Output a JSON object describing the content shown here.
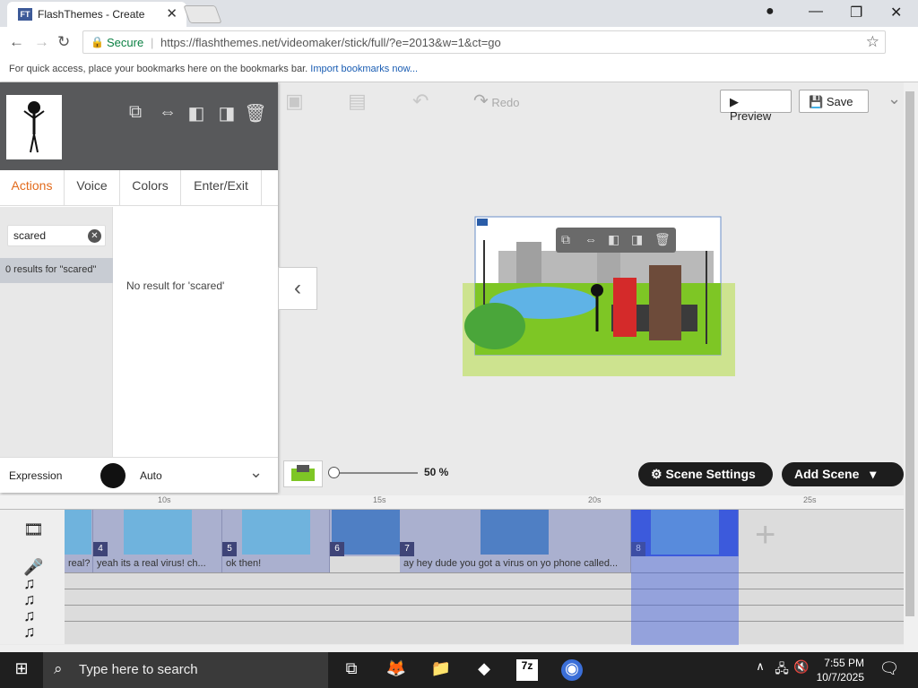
{
  "browser": {
    "tab_title": "FlashThemes - Create",
    "favicon_text": "FT",
    "secure_label": "Secure",
    "url": "https://flashthemes.net/videomaker/stick/full/?e=2013&w=1&ct=go",
    "bookmarks_prompt": "For quick access, place your bookmarks here on the bookmarks bar.",
    "bookmarks_link": "Import bookmarks now..."
  },
  "toolbar": {
    "redo_label": "Redo",
    "preview_label": "Preview",
    "save_label": "Save"
  },
  "panel": {
    "tabs": [
      "Actions",
      "Voice",
      "Colors",
      "Enter/Exit"
    ],
    "active_tab": "Actions",
    "search_value": "scared",
    "results_text": "0 results for \"scared\"",
    "no_result_text": "No result for 'scared'",
    "expression_label": "Expression",
    "expression_value": "Auto"
  },
  "stage_controls": {
    "zoom_value": "50 %",
    "scene_settings_label": "Scene Settings",
    "add_scene_label": "Add Scene"
  },
  "timeline": {
    "ruler_ticks": [
      "10s",
      "15s",
      "20s",
      "25s"
    ],
    "scenes": [
      {
        "num": "4"
      },
      {
        "num": "5"
      },
      {
        "num": "6"
      },
      {
        "num": "7"
      },
      {
        "num": "8"
      }
    ],
    "voice_clips": [
      "real?",
      "yeah its a real virus! ch...",
      "ok then!",
      "ay hey dude you got a virus on yo phone called..."
    ]
  },
  "taskbar": {
    "search_placeholder": "Type here to search",
    "time": "7:55 PM",
    "date": "10/7/2025"
  },
  "colors": {
    "accent_tab": "#e26a1b",
    "timeline_clip": "#aab0cf",
    "selection": "#3c5adc"
  }
}
